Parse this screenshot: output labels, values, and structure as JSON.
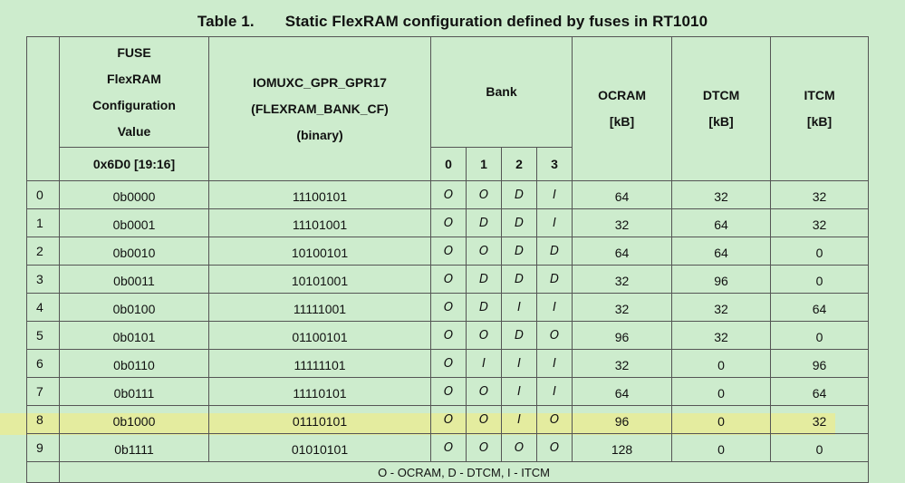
{
  "table": {
    "number": "Table 1.",
    "caption": "Static FlexRAM configuration defined by fuses in RT1010",
    "headers": {
      "fuse_lines": [
        "FUSE",
        "FlexRAM",
        "Configuration",
        "Value"
      ],
      "fuse_address": "0x6D0 [19:16]",
      "register_lines": [
        "IOMUXC_GPR_GPR17",
        "(FLEXRAM_BANK_CF)",
        "(binary)"
      ],
      "bank": "Bank",
      "bank_numbers": [
        "0",
        "1",
        "2",
        "3"
      ],
      "ocram_lines": [
        "OCRAM",
        "[kB]"
      ],
      "dtcm_lines": [
        "DTCM",
        "[kB]"
      ],
      "itcm_lines": [
        "ITCM",
        "[kB]"
      ]
    },
    "rows": [
      {
        "index": "0",
        "fuse": "0b0000",
        "binary": "11100101",
        "banks": [
          "O",
          "O",
          "D",
          "I"
        ],
        "ocram": "64",
        "dtcm": "32",
        "itcm": "32"
      },
      {
        "index": "1",
        "fuse": "0b0001",
        "binary": "11101001",
        "banks": [
          "O",
          "D",
          "D",
          "I"
        ],
        "ocram": "32",
        "dtcm": "64",
        "itcm": "32"
      },
      {
        "index": "2",
        "fuse": "0b0010",
        "binary": "10100101",
        "banks": [
          "O",
          "O",
          "D",
          "D"
        ],
        "ocram": "64",
        "dtcm": "64",
        "itcm": "0"
      },
      {
        "index": "3",
        "fuse": "0b0011",
        "binary": "10101001",
        "banks": [
          "O",
          "D",
          "D",
          "D"
        ],
        "ocram": "32",
        "dtcm": "96",
        "itcm": "0"
      },
      {
        "index": "4",
        "fuse": "0b0100",
        "binary": "11111001",
        "banks": [
          "O",
          "D",
          "I",
          "I"
        ],
        "ocram": "32",
        "dtcm": "32",
        "itcm": "64"
      },
      {
        "index": "5",
        "fuse": "0b0101",
        "binary": "01100101",
        "banks": [
          "O",
          "O",
          "D",
          "O"
        ],
        "ocram": "96",
        "dtcm": "32",
        "itcm": "0"
      },
      {
        "index": "6",
        "fuse": "0b0110",
        "binary": "11111101",
        "banks": [
          "O",
          "I",
          "I",
          "I"
        ],
        "ocram": "32",
        "dtcm": "0",
        "itcm": "96"
      },
      {
        "index": "7",
        "fuse": "0b0111",
        "binary": "11110101",
        "banks": [
          "O",
          "O",
          "I",
          "I"
        ],
        "ocram": "64",
        "dtcm": "0",
        "itcm": "64"
      },
      {
        "index": "8",
        "fuse": "0b1000",
        "binary": "01110101",
        "banks": [
          "O",
          "O",
          "I",
          "O"
        ],
        "ocram": "96",
        "dtcm": "0",
        "itcm": "32"
      },
      {
        "index": "9",
        "fuse": "0b1111",
        "binary": "01010101",
        "banks": [
          "O",
          "O",
          "O",
          "O"
        ],
        "ocram": "128",
        "dtcm": "0",
        "itcm": "0"
      }
    ],
    "legend": "O - OCRAM, D - DTCM, I - ITCM"
  }
}
